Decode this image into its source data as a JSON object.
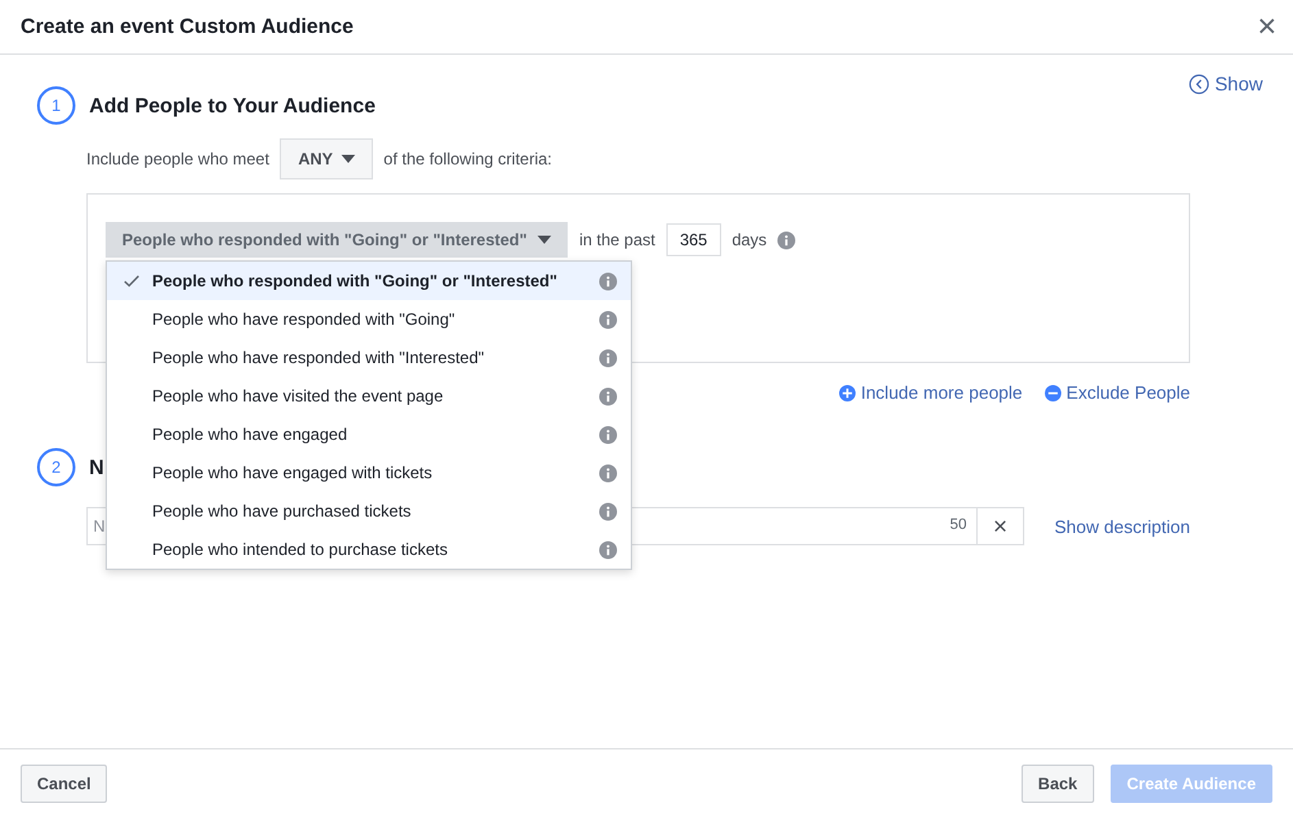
{
  "window": {
    "title": "Create an event Custom Audience",
    "close": "×"
  },
  "show_link": "Show",
  "step1": {
    "number": "1",
    "title": "Add People to Your Audience",
    "include_prefix": "Include people who meet",
    "match": "ANY",
    "include_suffix": "of the following criteria:",
    "criteria": {
      "dropdown": "People who responded with \"Going\" or \"Interested\"",
      "past_label": "in the past",
      "days": "365",
      "days_label": "days",
      "expanded": true,
      "options": [
        {
          "label": "People who responded with \"Going\" or \"Interested\"",
          "selected": true
        },
        {
          "label": "People who have responded with \"Going\"",
          "selected": false
        },
        {
          "label": "People who have responded with \"Interested\"",
          "selected": false
        },
        {
          "label": "People who have visited the event page",
          "selected": false
        },
        {
          "label": "People who have engaged",
          "selected": false
        },
        {
          "label": "People who have engaged with tickets",
          "selected": false
        },
        {
          "label": "People who have purchased tickets",
          "selected": false
        },
        {
          "label": "People who intended to purchase tickets",
          "selected": false
        }
      ]
    },
    "include_more": "Include more people",
    "exclude": "Exclude People"
  },
  "step2": {
    "number": "2",
    "title": "N",
    "name_field": {
      "placeholder": "N",
      "count": "50",
      "clear": "×"
    },
    "show_description": "Show description"
  },
  "footer": {
    "cancel": "Cancel",
    "back": "Back",
    "create": {
      "label": "Create Audience",
      "disabled": true
    }
  }
}
